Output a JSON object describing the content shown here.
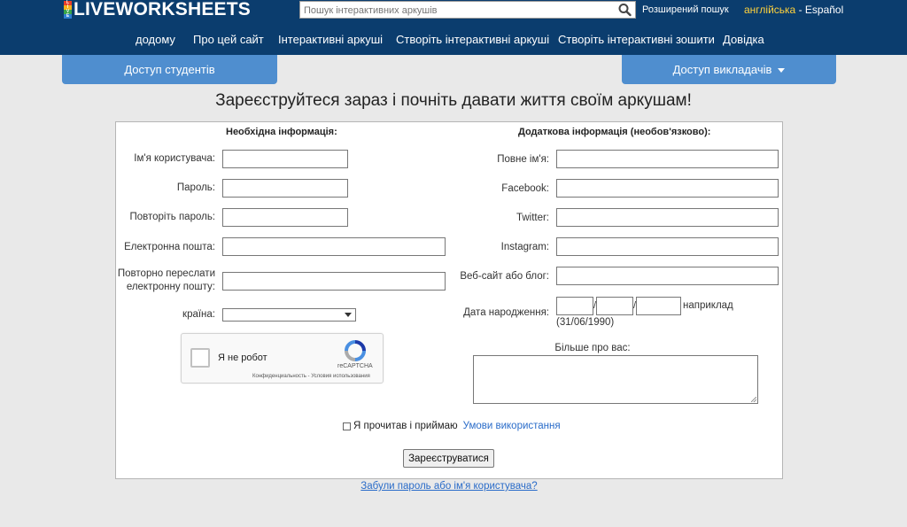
{
  "header": {
    "logo_letters": [
      "L",
      "I",
      "V",
      "E"
    ],
    "logo_text": "LIVEWORKSHEETS",
    "search_placeholder": "Пошук інтерактивних аркушів",
    "advanced_search": "Розширений пошук",
    "lang_current": "англійська",
    "lang_sep": " - ",
    "lang_alt": "Español",
    "colors": {
      "bar": "#0b3d6e",
      "accent_yellow": "#ffd23c",
      "tab": "#4f8ecf"
    }
  },
  "nav": {
    "items": [
      "додому",
      "Про цей сайт",
      "Інтерактивні аркуші",
      "Створіть інтерактивні аркуші",
      "Створіть інтерактивні зошити",
      "Довідка"
    ]
  },
  "tabs": {
    "students": "Доступ студентів",
    "teachers": "Доступ викладачів"
  },
  "headline": "Зареєструйтеся зараз і почніть давати життя своїм аркушам!",
  "required": {
    "title": "Необхідна інформація:",
    "username": "Ім'я користувача:",
    "password": "Пароль:",
    "repeat_password": "Повторіть пароль:",
    "email": "Електронна пошта:",
    "email_repeat_line1": "Повторно переслати",
    "email_repeat_line2": "електронну пошту:",
    "country": "країна:"
  },
  "captcha": {
    "label": "Я не робот",
    "brand": "reCAPTCHA",
    "links": "Конфиденциальность - Условия использования"
  },
  "optional": {
    "title": "Додаткова інформація (необов'язково):",
    "full_name": "Повне ім'я:",
    "facebook": "Facebook:",
    "twitter": "Twitter:",
    "instagram": "Instagram:",
    "website": "Веб-сайт або блог:",
    "birthdate": "Дата народження:",
    "date_sep": "/",
    "example_label": "наприклад",
    "example_value": "(31/06/1990)",
    "about": "Більше про вас:"
  },
  "terms": {
    "text": "Я прочитав і приймаю",
    "link": "Умови використання"
  },
  "submit": "Зареєструватися",
  "forgot": "Забули пароль або ім'я користувача?"
}
